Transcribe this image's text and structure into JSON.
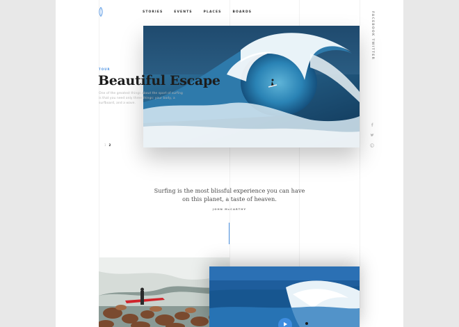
{
  "nav": {
    "items": [
      "STORIES",
      "EVENTS",
      "PLACES",
      "BOARDS"
    ]
  },
  "side_label": "FACEBOOK TWITTER",
  "hero": {
    "kicker": "TOUR",
    "title": "Beautiful Escape",
    "description": "One of the greatest things about the sport of surfing is that you need only three things: your body, a surfboard, and a wave.",
    "pager": [
      "1",
      "2"
    ]
  },
  "quote": {
    "line1": "Surfing is the most blissful experience you can have",
    "line2": "on this planet, a taste of heaven.",
    "author": "JOHN McCARTHY"
  },
  "colors": {
    "accent": "#4a90e2",
    "text_dark": "#1c1c1c"
  },
  "icons": [
    "facebook-icon",
    "twitter-icon",
    "pinterest-icon",
    "play-icon"
  ]
}
